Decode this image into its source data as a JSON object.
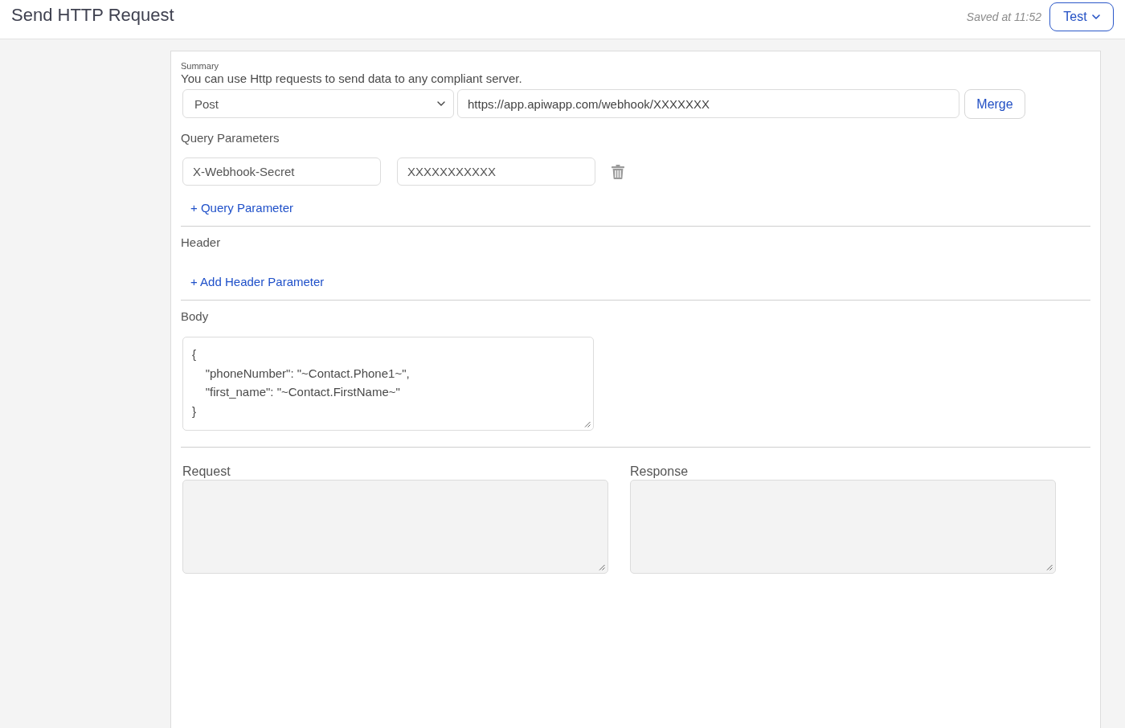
{
  "header": {
    "title": "Send HTTP Request",
    "saved_status": "Saved at 11:52",
    "test_button": "Test"
  },
  "form": {
    "summary_label": "Summary",
    "description": "You can use Http requests to send data to any compliant server.",
    "method": {
      "value": "Post"
    },
    "url": {
      "value": "https://app.apiwapp.com/webhook/XXXXXXX"
    },
    "merge_button": "Merge"
  },
  "query_parameters": {
    "title": "Query Parameters",
    "items": [
      {
        "key": "X-Webhook-Secret",
        "value": "XXXXXXXXXXX"
      }
    ],
    "add_link": "+ Query Parameter"
  },
  "header_section": {
    "title": "Header",
    "add_link": "+ Add Header Parameter"
  },
  "body": {
    "title": "Body",
    "value": "{\n    \"phoneNumber\": \"~Contact.Phone1~\",\n    \"first_name\": \"~Contact.FirstName~\"\n}"
  },
  "output": [
    {
      "label": "Request",
      "disabled": true
    },
    {
      "label": "Response",
      "disabled": true
    }
  ]
}
